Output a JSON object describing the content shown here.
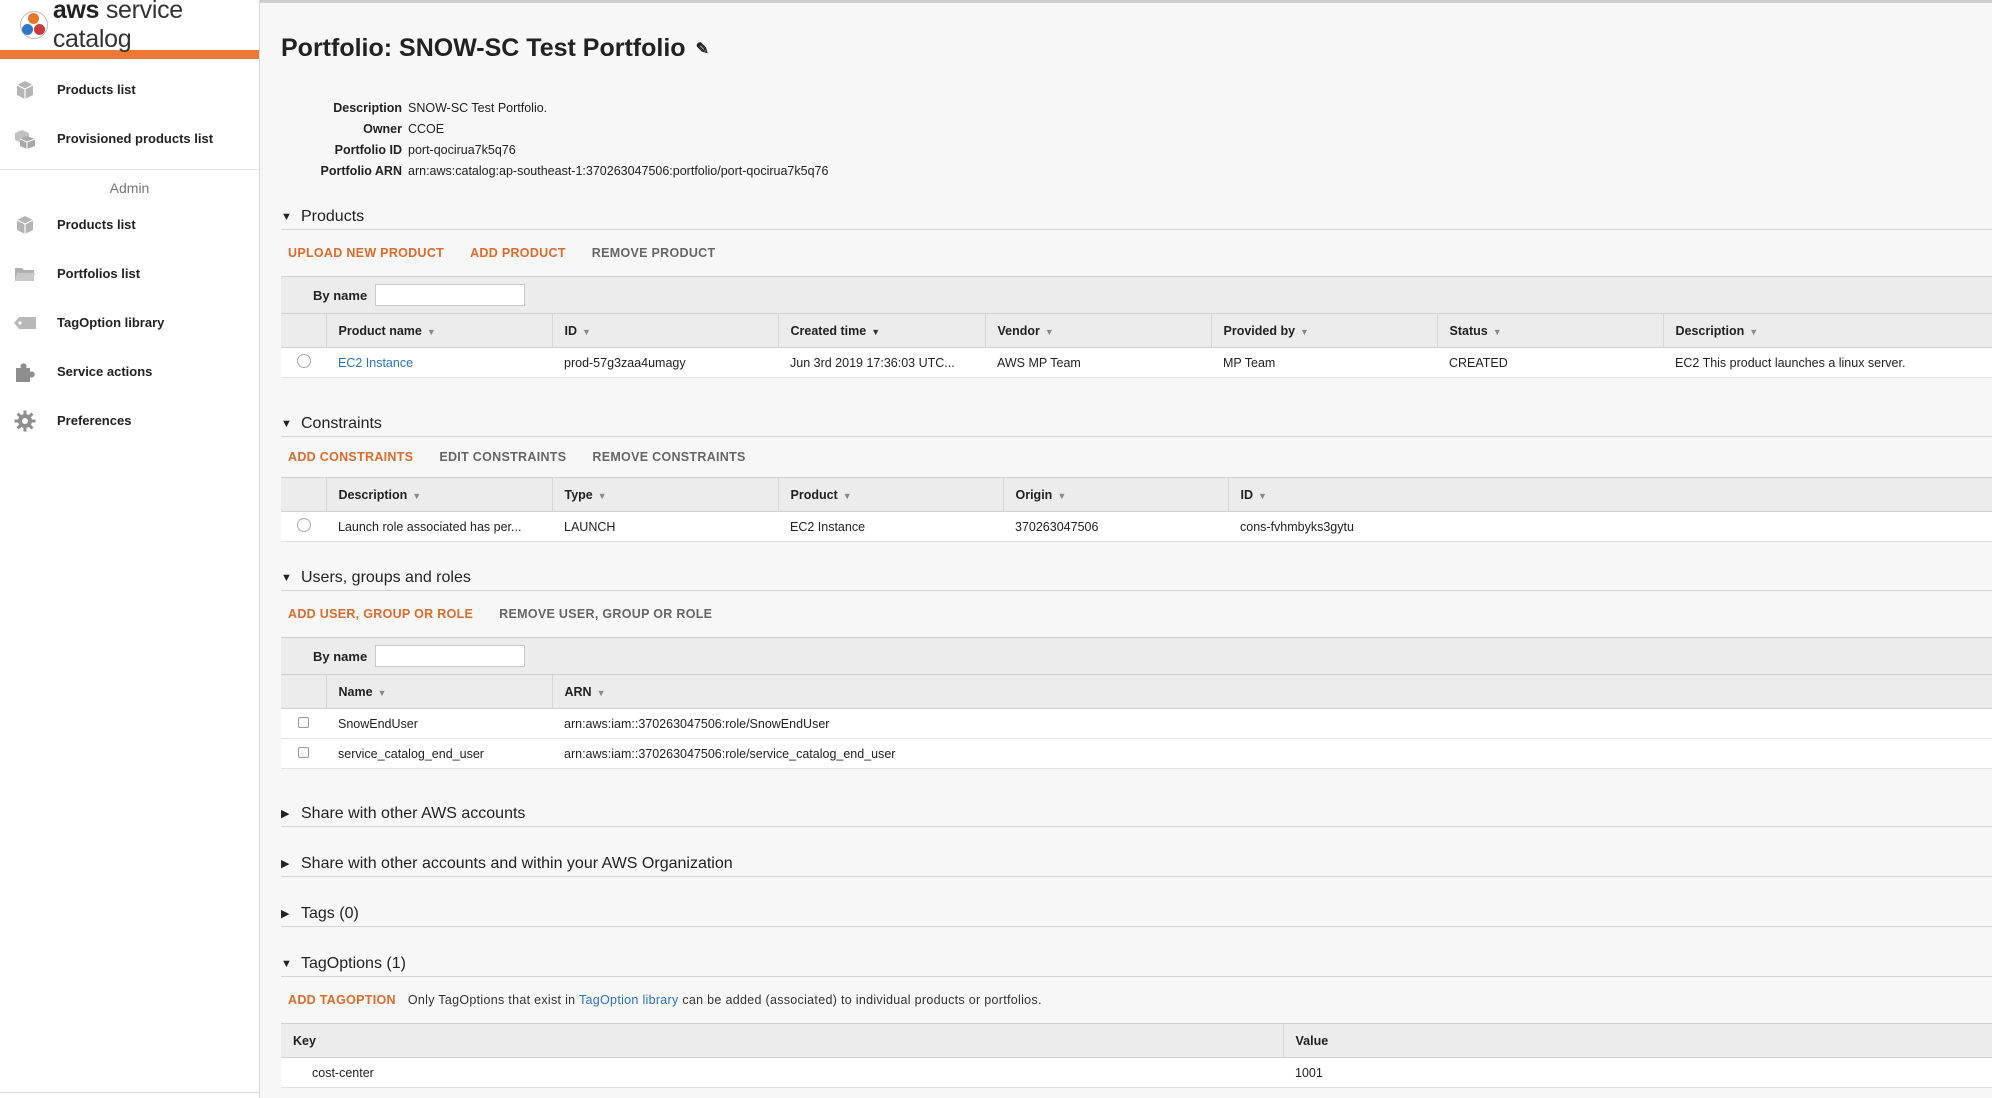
{
  "brand": {
    "bold": "aws",
    "rest": " service catalog"
  },
  "sidebar": {
    "items": [
      {
        "label": "Products list",
        "icon": "box-icon"
      },
      {
        "label": "Provisioned products list",
        "icon": "boxes-icon"
      }
    ],
    "admin_label": "Admin",
    "admin_items": [
      {
        "label": "Products list",
        "icon": "box-icon"
      },
      {
        "label": "Portfolios list",
        "icon": "folder-icon"
      },
      {
        "label": "TagOption library",
        "icon": "tag-icon"
      },
      {
        "label": "Service actions",
        "icon": "puzzle-icon"
      },
      {
        "label": "Preferences",
        "icon": "gear-icon"
      }
    ]
  },
  "page": {
    "title": "Portfolio: SNOW-SC Test Portfolio",
    "details": [
      {
        "key": "Description",
        "value": "SNOW-SC Test Portfolio."
      },
      {
        "key": "Owner",
        "value": "CCOE"
      },
      {
        "key": "Portfolio ID",
        "value": "port-qocirua7k5q76"
      },
      {
        "key": "Portfolio ARN",
        "value": "arn:aws:catalog:ap-southeast-1:370263047506:portfolio/port-qocirua7k5q76"
      }
    ]
  },
  "products": {
    "title": "Products",
    "actions": [
      "UPLOAD NEW PRODUCT",
      "ADD PRODUCT",
      "REMOVE PRODUCT"
    ],
    "filter_label": "By name",
    "columns": [
      "Product name",
      "ID",
      "Created time",
      "Vendor",
      "Provided by",
      "Status",
      "Description"
    ],
    "rows": [
      [
        "EC2 Instance",
        "prod-57g3zaa4umagy",
        "Jun 3rd 2019 17:36:03 UTC...",
        "AWS MP Team",
        "MP Team",
        "CREATED",
        "EC2 This product launches a linux server."
      ]
    ]
  },
  "constraints": {
    "title": "Constraints",
    "actions": [
      "ADD CONSTRAINTS",
      "EDIT CONSTRAINTS",
      "REMOVE CONSTRAINTS"
    ],
    "columns": [
      "Description",
      "Type",
      "Product",
      "Origin",
      "ID"
    ],
    "rows": [
      [
        "Launch role associated has per...",
        "LAUNCH",
        "EC2 Instance",
        "370263047506",
        "cons-fvhmbyks3gytu"
      ]
    ]
  },
  "users": {
    "title": "Users, groups and roles",
    "actions": [
      "ADD USER, GROUP OR ROLE",
      "REMOVE USER, GROUP OR ROLE"
    ],
    "filter_label": "By name",
    "columns": [
      "Name",
      "ARN"
    ],
    "rows": [
      [
        "SnowEndUser",
        "arn:aws:iam::370263047506:role/SnowEndUser"
      ],
      [
        "service_catalog_end_user",
        "arn:aws:iam::370263047506:role/service_catalog_end_user"
      ]
    ]
  },
  "collapsed_sections": [
    "Share with other AWS accounts",
    "Share with other accounts and within your AWS Organization",
    "Tags (0)"
  ],
  "tagoptions": {
    "title": "TagOptions (1)",
    "action": "ADD TAGOPTION",
    "note_pre": "Only TagOptions that exist in ",
    "note_link": "TagOption library",
    "note_post": " can be added (associated) to individual products or portfolios.",
    "columns": [
      "Key",
      "Value"
    ],
    "rows": [
      [
        "cost-center",
        "1001"
      ]
    ]
  },
  "colors": {
    "accent": "#ec7a36",
    "action": "#dd6b2b",
    "link": "#2a72c1"
  }
}
